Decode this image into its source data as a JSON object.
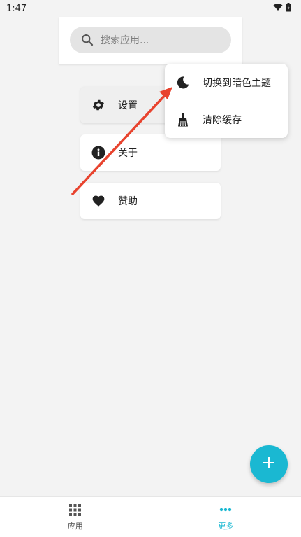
{
  "status_bar": {
    "time": "1:47"
  },
  "search": {
    "placeholder": "搜索应用..."
  },
  "menu": {
    "items": [
      {
        "label": "设置",
        "icon": "gear-icon"
      },
      {
        "label": "关于",
        "icon": "info-icon"
      },
      {
        "label": "赞助",
        "icon": "heart-icon"
      }
    ]
  },
  "popup": {
    "items": [
      {
        "label": "切换到暗色主题",
        "icon": "moon-icon"
      },
      {
        "label": "清除缓存",
        "icon": "broom-icon"
      }
    ]
  },
  "bottom_nav": {
    "items": [
      {
        "label": "应用",
        "icon": "grid-icon",
        "active": false
      },
      {
        "label": "更多",
        "icon": "more-dots-icon",
        "active": true
      }
    ]
  },
  "colors": {
    "accent": "#1ab8d2",
    "arrow": "#e8432e"
  }
}
